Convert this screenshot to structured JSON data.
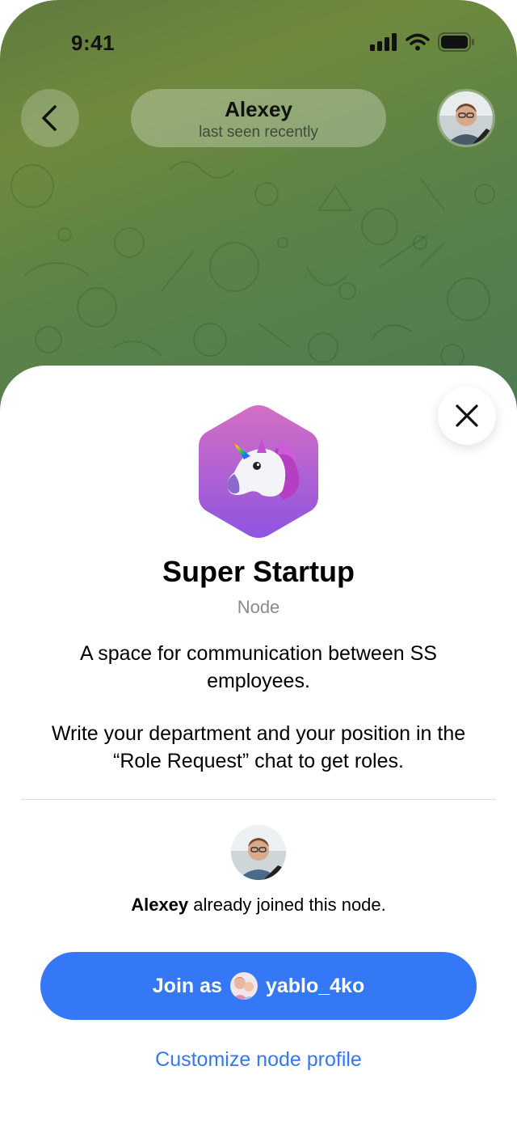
{
  "status_bar": {
    "time": "9:41"
  },
  "header": {
    "name": "Alexey",
    "status": "last seen recently"
  },
  "node": {
    "title": "Super Startup",
    "type": "Node",
    "description_1": "A space for communication between SS employees.",
    "description_2": "Write your department and your position in the “Role Request” chat to get roles."
  },
  "joined": {
    "name": "Alexey",
    "text": " already joined this node."
  },
  "join_button": {
    "prefix": "Join as",
    "username": "yablo_4ko"
  },
  "customize_link": "Customize node profile",
  "colors": {
    "accent": "#3478f6",
    "logo_top": "#d46fc4",
    "logo_bottom": "#8e54e0"
  }
}
